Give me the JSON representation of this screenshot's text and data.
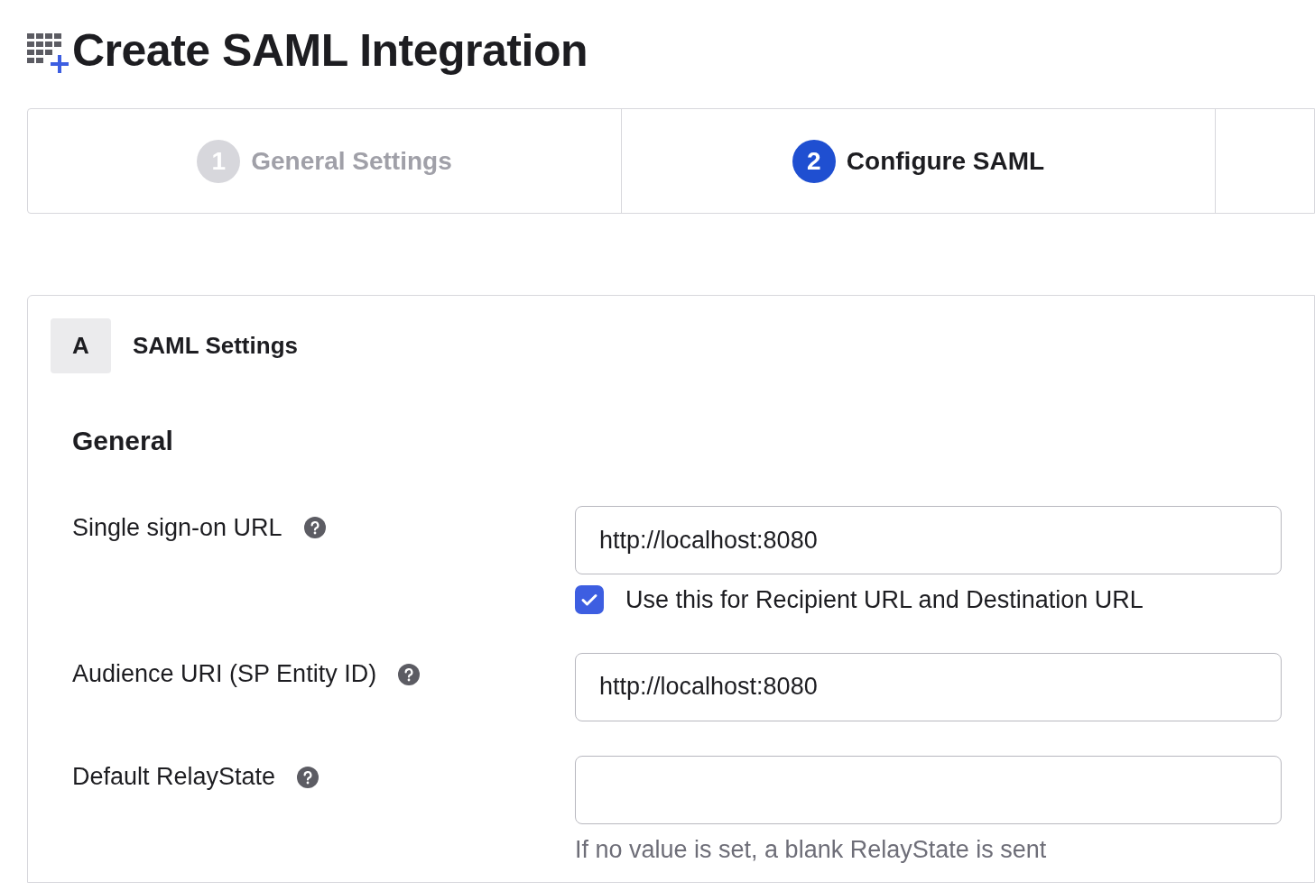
{
  "title": "Create SAML Integration",
  "steps": [
    {
      "number": "1",
      "label": "General Settings",
      "selected": false
    },
    {
      "number": "2",
      "label": "Configure SAML",
      "selected": true
    }
  ],
  "section": {
    "badge": "A",
    "title": "SAML Settings",
    "subheading": "General",
    "fields": [
      {
        "label": "Single sign-on URL",
        "value": "http://localhost:8080",
        "checkbox": {
          "label": "Use this for Recipient URL and Destination URL",
          "checked": true
        }
      },
      {
        "label": "Audience URI (SP Entity ID)",
        "value": "http://localhost:8080"
      },
      {
        "label": "Default RelayState",
        "hint": "If no value is set, a blank RelayState is sent"
      }
    ]
  }
}
